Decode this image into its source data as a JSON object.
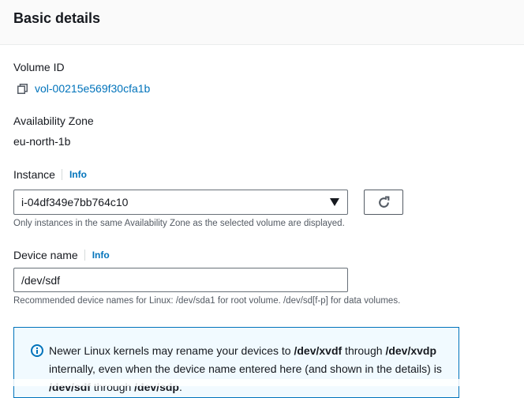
{
  "header": {
    "title": "Basic details"
  },
  "volume": {
    "label": "Volume ID",
    "id": "vol-00215e569f30cfa1b",
    "copy_icon": "copy-icon"
  },
  "availability": {
    "label": "Availability Zone",
    "value": "eu-north-1b"
  },
  "instance": {
    "label": "Instance",
    "info": "Info",
    "selected": "i-04df349e7bb764c10",
    "hint": "Only instances in the same Availability Zone as the selected volume are displayed.",
    "refresh_icon": "refresh-icon"
  },
  "device": {
    "label": "Device name",
    "info": "Info",
    "value": "/dev/sdf",
    "hint": "Recommended device names for Linux: /dev/sda1 for root volume. /dev/sd[f-p] for data volumes."
  },
  "alert": {
    "icon": "info-circle-icon",
    "text1": "Newer Linux kernels may rename your devices to ",
    "bold1": "/dev/xvdf",
    "text2": " through ",
    "bold2": "/dev/xvdp",
    "text3": " internally, even when the device name entered here (and shown in the details) is ",
    "bold3": "/dev/sdf",
    "text4": " through ",
    "bold4": "/dev/sdp",
    "text5": "."
  },
  "colors": {
    "link": "#0073bb",
    "alert_bg": "#f1faff",
    "alert_border": "#0073bb",
    "hint_text": "#545b64"
  }
}
